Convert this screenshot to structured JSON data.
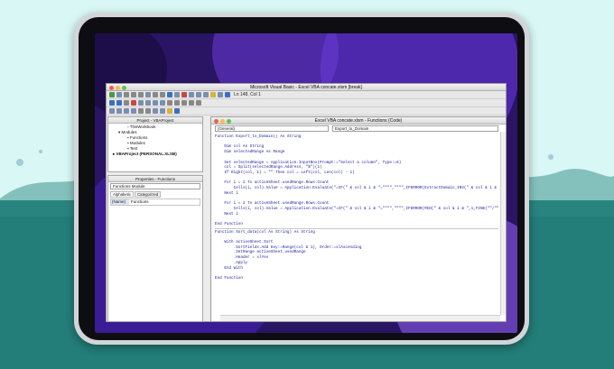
{
  "window": {
    "title": "Microsoft Visual Basic - Excel VBA concate.xlsm [break]",
    "position": "Ln 148, Col 1"
  },
  "project": {
    "title": "Project - VBAProject",
    "items": [
      "ThisWorkbook",
      "Modules",
      "Functions",
      "Module1",
      "Test",
      "VBAProject (PERSONAL.XLSB)"
    ]
  },
  "properties": {
    "title": "Properties - Functions",
    "selected": "Functions Module",
    "tabs": [
      "Alphabetic",
      "Categorized"
    ],
    "row_name": "(Name)",
    "row_value": "Functions"
  },
  "code_window": {
    "title": "Excel VBA concate.xlsm - Functions (Code)",
    "object_combo": "(General)",
    "proc_combo": "Export_to_Domain",
    "lines": [
      "Function Export_to_Domain() As String",
      "",
      "    Dim col As String",
      "    Dim selectedRange As Range",
      "",
      "    Set selectedRange = Application.InputBox(Prompt:=\"Select a column\", Type:=8)",
      "    col = Split(selectedRange.Address, \"$\")(1)",
      "    If Right(col, 1) = \"\" Then col = Left(col, Len(col) - 1)",
      "",
      "    For i = 2 To activeSheet.usedRange.Rows.Count",
      "        Cells(i, col).Value = Application.Evaluate(\"=IF(\" & col & i & \"=\"\"\"\",\"\"\"\",IFERROR(ExtractDomain_INV(\" & col & i & \"),\" & col & i & \"))\")",
      "    Next i",
      "",
      "    For i = 2 To activeSheet.usedRange.Rows.Count",
      "        Cells(i, col).Value = Application.Evaluate(\"=IF(\" & col & i & \"=\"\"\"\",\"\"\"\",IFERROR(MID(\" & col & i & \",1,FIND(\"\"/\"\",\" & col & i & \")-1),\" & col & i & \"))\")",
      "    Next i",
      "",
      "End Function",
      "---",
      "Function Sort_data(col As String) As String",
      "",
      "    With activeSheet.Sort",
      "        .SortFields.Add Key:=Range(col & 1), Order:=xlAscending",
      "        .SetRange activeSheet.usedRange",
      "        .Header = xlYes",
      "        .Apply",
      "    End With",
      "",
      "End Function"
    ]
  },
  "colors": {
    "accent": "#3b6fc4",
    "code_text": "#1a1a99",
    "bg_teal": "#237d78"
  }
}
